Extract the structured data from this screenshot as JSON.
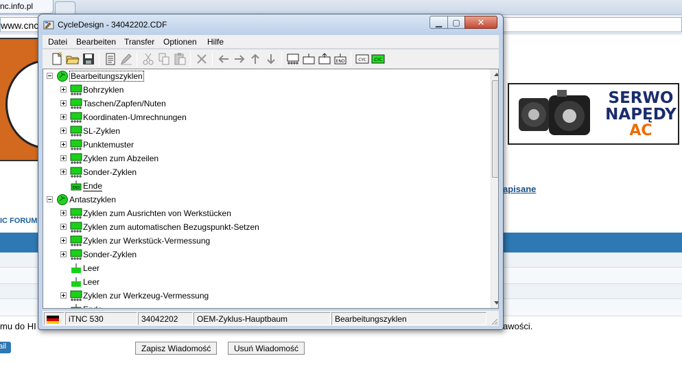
{
  "browser": {
    "tab_title": "nc.info.pl",
    "address": "www.cnc"
  },
  "background_page": {
    "ad": {
      "line1": "SERWO",
      "line2": "NAPĘDY",
      "line3": "AC"
    },
    "link_zapisane": "apisane",
    "forum_label": "IC FORUM",
    "text_left": "mu do HI",
    "text_right": "awości.",
    "mail_button": "ail",
    "save_button": "Zapisz Wiadomość",
    "delete_button": "Usuń Wiadomość"
  },
  "window": {
    "title": "CycleDesign - 34042202.CDF",
    "menu": [
      "Datei",
      "Bearbeiten",
      "Transfer",
      "Optionen",
      "Hilfe"
    ],
    "toolbar_icons": [
      "new-file-icon",
      "open-folder-icon",
      "save-disk-icon",
      "document-list-icon",
      "edit-pen-icon",
      "cut-icon",
      "copy-icon",
      "paste-icon",
      "delete-x-icon",
      "arrow-left-icon",
      "arrow-right-icon",
      "arrow-up-icon",
      "arrow-down-icon",
      "cycle-block-icon",
      "insert-cycle-icon",
      "insert-above-icon",
      "end-marker-icon",
      "cyc-icon",
      "cyc-green-icon"
    ],
    "tree": [
      {
        "level": 0,
        "expander": "minus",
        "icon": "globe",
        "label": "Bearbeitungszyklen",
        "selected": true
      },
      {
        "level": 1,
        "expander": "plus",
        "icon": "cycle",
        "label": "Bohrzyklen"
      },
      {
        "level": 1,
        "expander": "plus",
        "icon": "cycle",
        "label": "Taschen/Zapfen/Nuten"
      },
      {
        "level": 1,
        "expander": "plus",
        "icon": "cycle",
        "label": "Koordinaten-Umrechnungen"
      },
      {
        "level": 1,
        "expander": "plus",
        "icon": "cycle",
        "label": "SL-Zyklen"
      },
      {
        "level": 1,
        "expander": "plus",
        "icon": "cycle",
        "label": "Punktemuster"
      },
      {
        "level": 1,
        "expander": "plus",
        "icon": "cycle",
        "label": "Zyklen zum Abzeilen"
      },
      {
        "level": 1,
        "expander": "plus",
        "icon": "cycle",
        "label": "Sonder-Zyklen"
      },
      {
        "level": 1,
        "expander": "none",
        "icon": "end",
        "label": "Ende",
        "underline": true
      },
      {
        "level": 0,
        "expander": "minus",
        "icon": "globe",
        "label": "Antastzyklen"
      },
      {
        "level": 1,
        "expander": "plus",
        "icon": "cycle",
        "label": "Zyklen zum Ausrichten von Werkstücken"
      },
      {
        "level": 1,
        "expander": "plus",
        "icon": "cycle",
        "label": "Zyklen zum automatischen Bezugspunkt-Setzen"
      },
      {
        "level": 1,
        "expander": "plus",
        "icon": "cycle",
        "label": "Zyklen zur Werkstück-Vermessung"
      },
      {
        "level": 1,
        "expander": "plus",
        "icon": "cycle",
        "label": "Sonder-Zyklen"
      },
      {
        "level": 1,
        "expander": "none",
        "icon": "empty",
        "label": "Leer"
      },
      {
        "level": 1,
        "expander": "none",
        "icon": "empty",
        "label": "Leer"
      },
      {
        "level": 1,
        "expander": "plus",
        "icon": "cycle",
        "label": "Zyklen zur Werkzeug-Vermessung"
      },
      {
        "level": 1,
        "expander": "none",
        "icon": "end",
        "label": "Ende"
      }
    ],
    "status": {
      "control": "iTNC 530",
      "file_id": "34042202",
      "tree_name": "OEM-Zyklus-Hauptbaum",
      "selection": "Bearbeitungszyklen"
    }
  }
}
